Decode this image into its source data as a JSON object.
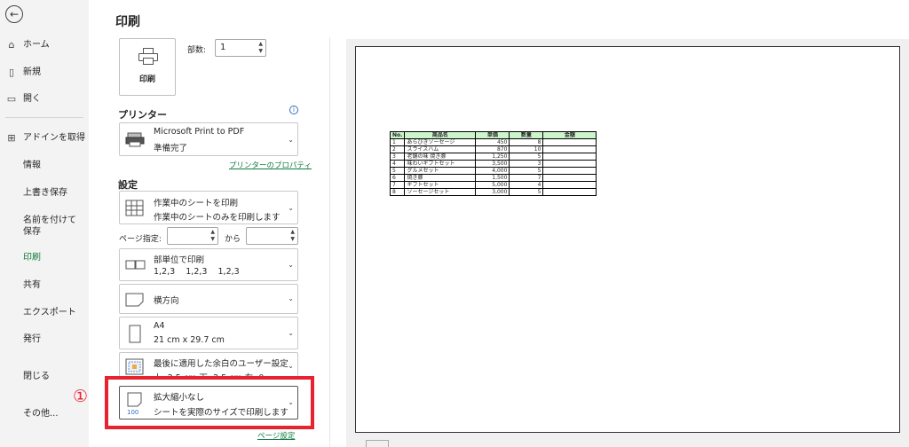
{
  "nav": {
    "back_icon": "back-arrow-icon",
    "home": "ホーム",
    "new": "新規",
    "open": "開く",
    "addins": "アドインを取得",
    "info": "情報",
    "save": "上書き保存",
    "save_as": "名前を付けて保存",
    "print": "印刷",
    "share": "共有",
    "export": "エクスポート",
    "publish": "発行",
    "close": "閉じる",
    "more": "その他..."
  },
  "print": {
    "title": "印刷",
    "button_label": "印刷",
    "copies_label": "部数:",
    "copies_value": "1"
  },
  "printer": {
    "heading": "プリンター",
    "name": "Microsoft Print to PDF",
    "status": "準備完了",
    "properties_link": "プリンターのプロパティ"
  },
  "settings": {
    "heading": "設定",
    "scope_title": "作業中のシートを印刷",
    "scope_sub": "作業中のシートのみを印刷します",
    "pages_label": "ページ指定:",
    "pages_to": "から",
    "collate_title": "部単位で印刷",
    "collate_sub": "1,2,3    1,2,3    1,2,3",
    "orientation": "横方向",
    "paper_title": "A4",
    "paper_sub": "21 cm x 29.7 cm",
    "margins_title": "最後に適用した余白のユーザー設定",
    "margins_sub": "上: 2.5 cm 下: 2.5 cm 左: 0...",
    "scaling_title": "拡大縮小なし",
    "scaling_sub": "シートを実際のサイズで印刷します",
    "page_setup_link": "ページ設定"
  },
  "annotation": {
    "marker": "①",
    "color": "#e8232f"
  },
  "sheet": {
    "headers": [
      "No.",
      "商品名",
      "単価",
      "数量",
      "金額"
    ],
    "rows": [
      [
        "1",
        "あらびきソーセージ",
        "450",
        "8",
        ""
      ],
      [
        "2",
        "スライスハム",
        "870",
        "10",
        ""
      ],
      [
        "3",
        "老舗の味 焼き豚",
        "1,250",
        "5",
        ""
      ],
      [
        "4",
        "味わいギフトセット",
        "3,500",
        "3",
        ""
      ],
      [
        "5",
        "グルメセット",
        "4,000",
        "5",
        ""
      ],
      [
        "6",
        "焼き豚",
        "1,500",
        "7",
        ""
      ],
      [
        "7",
        "ギフトセット",
        "5,000",
        "4",
        ""
      ],
      [
        "8",
        "ソーセージセット",
        "3,000",
        "5",
        ""
      ]
    ],
    "header_color": "#ccf5cc"
  }
}
